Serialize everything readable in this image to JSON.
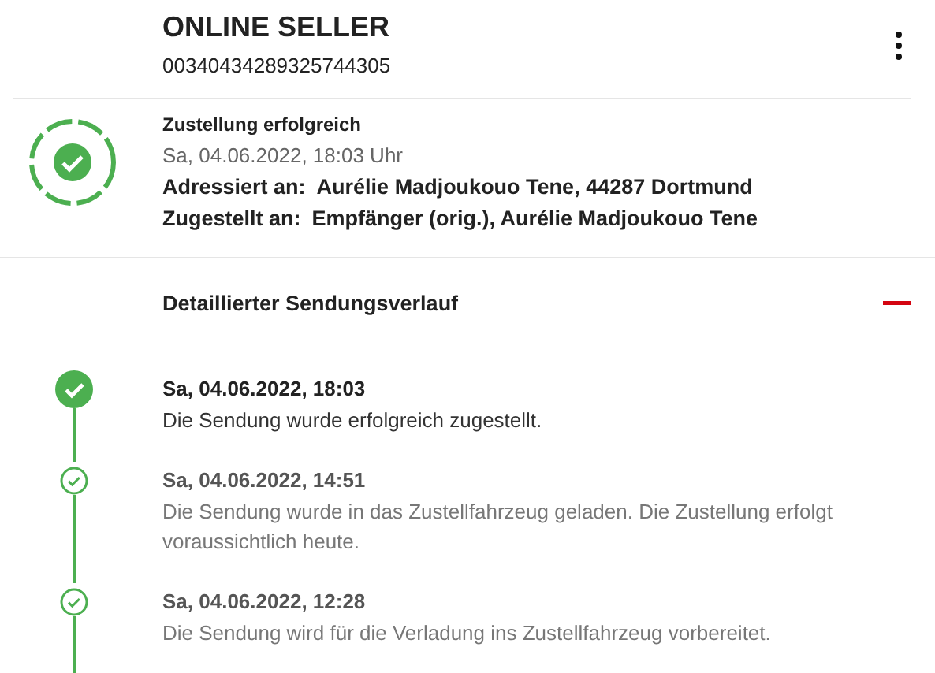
{
  "header": {
    "title": "ONLINE SELLER",
    "tracking_number": "00340434289325744305"
  },
  "status": {
    "delivered": true,
    "title": "Zustellung erfolgreich",
    "datetime": "Sa, 04.06.2022, 18:03 Uhr",
    "details": [
      {
        "label": "Adressiert an:",
        "value": "Aurélie Madjoukouo Tene, 44287 Dortmund"
      },
      {
        "label": "Zugestellt an:",
        "value": "Empfänger (orig.), Aurélie Madjoukouo Tene"
      }
    ]
  },
  "history": {
    "title": "Detaillierter Sendungsverlauf",
    "expanded": true,
    "events": [
      {
        "latest": true,
        "datetime": "Sa, 04.06.2022, 18:03",
        "text": "Die Sendung wurde erfolgreich zugestellt."
      },
      {
        "latest": false,
        "datetime": "Sa, 04.06.2022, 14:51",
        "text": "Die Sendung wurde in das Zustellfahrzeug geladen. Die Zustellung erfolgt voraussichtlich heute."
      },
      {
        "latest": false,
        "datetime": "Sa, 04.06.2022, 12:28",
        "text": "Die Sendung wird für die Verladung ins Zustellfahrzeug vorbereitet."
      }
    ]
  }
}
